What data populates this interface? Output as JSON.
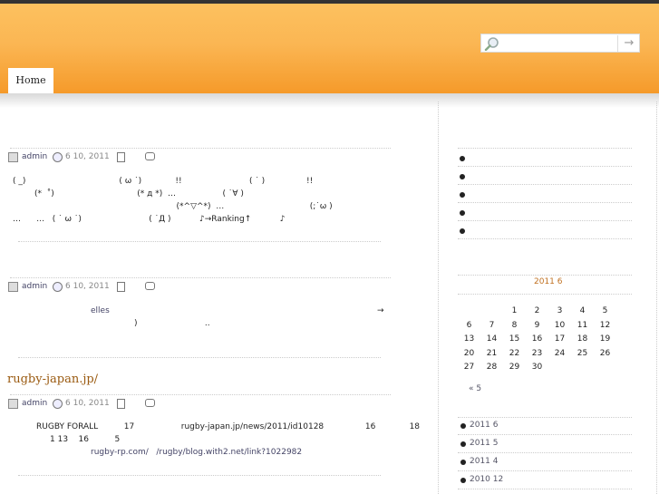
{
  "nav": {
    "home_label": "Home"
  },
  "search": {
    "placeholder": "",
    "go_icon": "arrow-right-icon",
    "go_glyph": "→"
  },
  "posts": [
    {
      "meta": {
        "author": "admin",
        "date": "6 10, 2011"
      },
      "lines": [
        "( _)                                    ( ω ˙)             !!                          ( ˙ )                !!",
        "(*  ˚)                                (* д *)  …                  ( ˙∀ )",
        "                                                                    (*^▽^*)  …                                 (;˙ω )",
        "…      …   ( ˙ ω ˙)                          ( ˙Д )           ♪→Ranking↑           ♪"
      ]
    },
    {
      "meta": {
        "author": "admin",
        "date": "6 10, 2011"
      },
      "link_text": "elles",
      "arrow": "→",
      "line2": ")                          .."
    },
    {
      "title": "rugby-japan.jp/",
      "meta": {
        "author": "admin",
        "date": "6 10, 2011"
      },
      "line1": "RUGBY FORALL          17                  rugby-japan.jp/news/2011/id10128                16             18",
      "line2": "1 13    16          5",
      "line3": "rugby-rp.com/   /rugby/blog.with2.net/link?1022982"
    }
  ],
  "calendar": {
    "title": "2011 6",
    "rows": [
      [
        "",
        "",
        "1",
        "2",
        "3",
        "4",
        "5"
      ],
      [
        "6",
        "7",
        "8",
        "9",
        "10",
        "11",
        "12"
      ],
      [
        "13",
        "14",
        "15",
        "16",
        "17",
        "18",
        "19"
      ],
      [
        "20",
        "21",
        "22",
        "23",
        "24",
        "25",
        "26"
      ],
      [
        "27",
        "28",
        "29",
        "30",
        "",
        "",
        ""
      ]
    ],
    "prev": "« 5"
  },
  "archives": [
    "2011 6",
    "2011 5",
    "2011 4",
    "2010 12"
  ]
}
